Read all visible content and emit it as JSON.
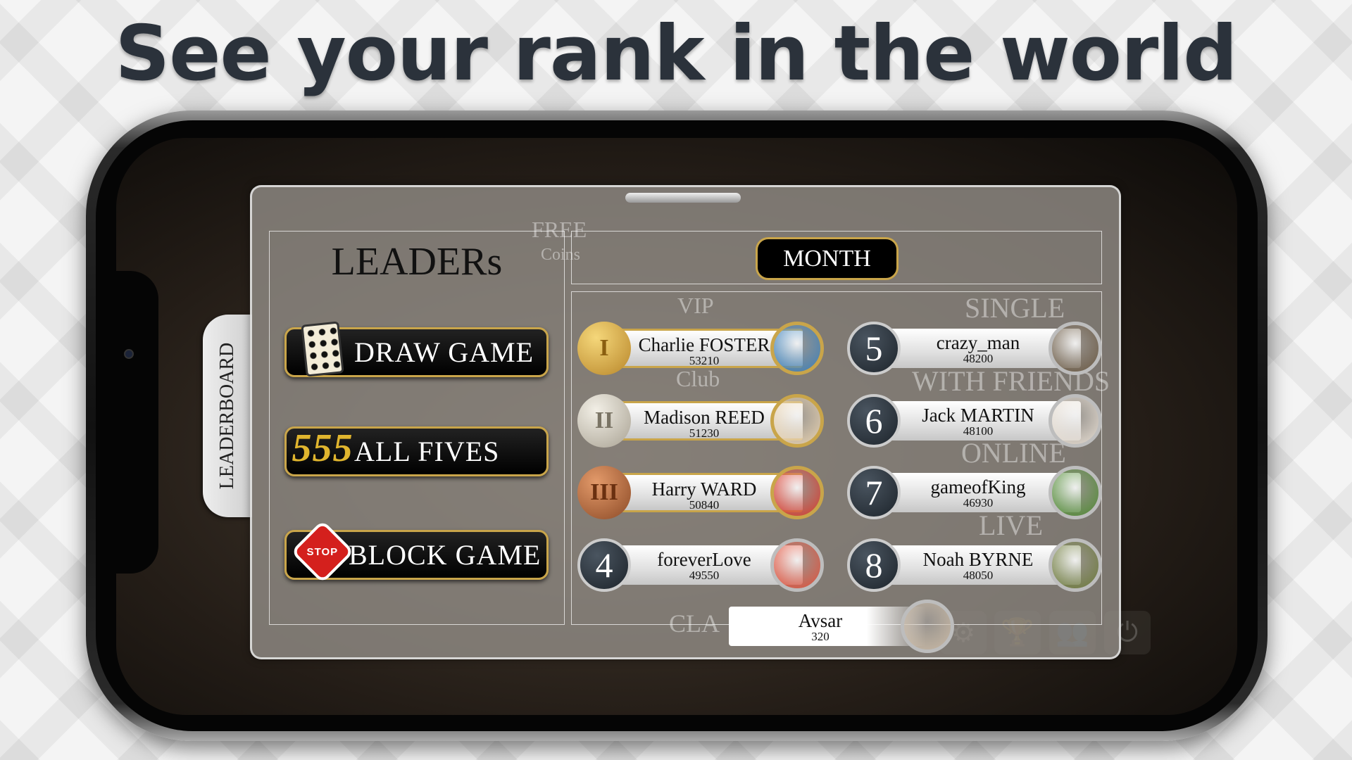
{
  "headline": "See your rank in the world",
  "panel": {
    "title": "LEADERs",
    "tab_label": "LEADERBOARD",
    "period_label": "MONTH"
  },
  "modes": [
    {
      "label": "DRAW GAME",
      "icon": "domino-tile-icon"
    },
    {
      "label": "ALL FIVES",
      "icon": "fives-icon"
    },
    {
      "label": "BLOCK GAME",
      "icon": "stop-sign-icon"
    }
  ],
  "background_menu": {
    "items": [
      "SINGLE",
      "WITH FRIENDS",
      "ONLINE",
      "LIVE"
    ],
    "free_coins": [
      "FREE",
      "Coins"
    ],
    "vip": [
      "VIP",
      "Club"
    ],
    "classic": "CLA"
  },
  "leaderboard": [
    {
      "rank": 1,
      "name": "Charlie FOSTER",
      "score": "53210",
      "medal": "gold",
      "medal_text": "I",
      "avatar_color": "#3b7fb8"
    },
    {
      "rank": 2,
      "name": "Madison REED",
      "score": "51230",
      "medal": "silver",
      "medal_text": "II",
      "avatar_color": "#e8d2b0"
    },
    {
      "rank": 3,
      "name": "Harry WARD",
      "score": "50840",
      "medal": "bronze",
      "medal_text": "III",
      "avatar_color": "#d63a2c"
    },
    {
      "rank": 4,
      "name": "foreverLove",
      "score": "49550",
      "avatar_color": "#e0503a"
    },
    {
      "rank": 5,
      "name": "crazy_man",
      "score": "48200",
      "avatar_color": "#6b5a44"
    },
    {
      "rank": 6,
      "name": "Jack MARTIN",
      "score": "48100",
      "avatar_color": "#e6ddd2"
    },
    {
      "rank": 7,
      "name": "gameofKing",
      "score": "46930",
      "avatar_color": "#4f8a32"
    },
    {
      "rank": 8,
      "name": "Noah BYRNE",
      "score": "48050",
      "avatar_color": "#6d7a3a"
    }
  ],
  "current_user": {
    "name": "Avsar",
    "score": "320",
    "avatar_color": "#c9b9a5"
  },
  "colors": {
    "gold": "#c9a54a",
    "silver": "#bdbdbd",
    "bronze": "#b86a3c",
    "rank_badge": "#1d242b"
  }
}
